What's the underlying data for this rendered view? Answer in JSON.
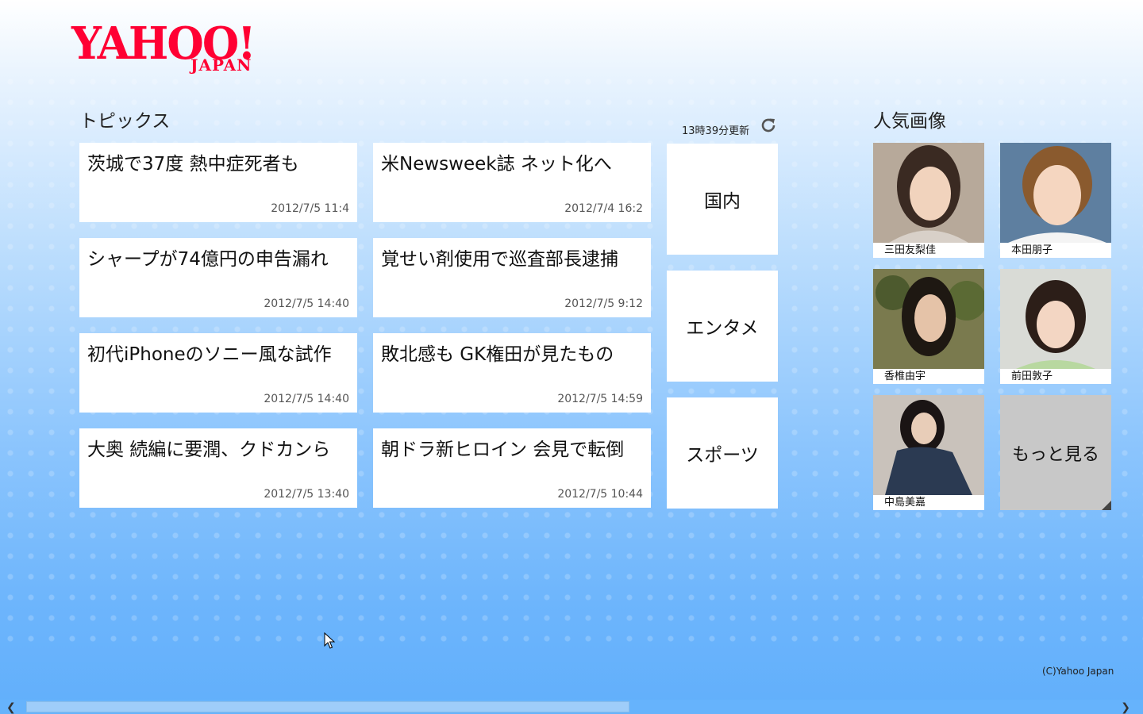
{
  "logo": {
    "main": "YAHOO!",
    "sub": "JAPAN"
  },
  "topics": {
    "title": "トピックス",
    "updated": "13時39分更新",
    "items": [
      {
        "headline": "茨城で37度 熱中症死者も",
        "date": "2012/7/5 11:4"
      },
      {
        "headline": "米Newsweek誌 ネット化へ",
        "date": "2012/7/4 16:2"
      },
      {
        "headline": "シャープが74億円の申告漏れ",
        "date": "2012/7/5 14:40"
      },
      {
        "headline": "覚せい剤使用で巡査部長逮捕",
        "date": "2012/7/5 9:12"
      },
      {
        "headline": "初代iPhoneのソニー風な試作",
        "date": "2012/7/5 14:40"
      },
      {
        "headline": "敗北感も GK権田が見たもの",
        "date": "2012/7/5 14:59"
      },
      {
        "headline": "大奥 続編に要潤、クドカンら",
        "date": "2012/7/5 13:40"
      },
      {
        "headline": "朝ドラ新ヒロイン 会見で転倒",
        "date": "2012/7/5 10:44"
      }
    ],
    "categories": [
      "国内",
      "エンタメ",
      "スポーツ"
    ]
  },
  "popular": {
    "title": "人気画像",
    "images": [
      {
        "name": "三田友梨佳"
      },
      {
        "name": "本田朋子"
      },
      {
        "name": "香椎由宇"
      },
      {
        "name": "前田敦子"
      },
      {
        "name": "中島美嘉"
      }
    ],
    "more_label": "もっと見る"
  },
  "footer": {
    "copyright": "(C)Yahoo Japan"
  },
  "colors": {
    "brand": "#ff0033",
    "background": "#8cc5fd",
    "tile": "#ffffff",
    "more_tile": "#c8c8c8"
  }
}
